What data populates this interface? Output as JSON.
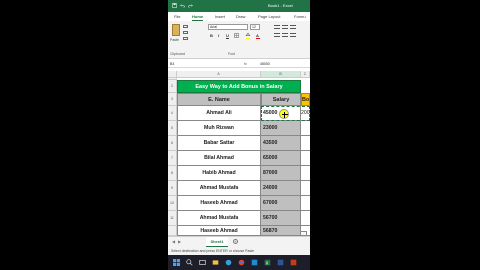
{
  "window": {
    "title": "Book1 - Excel",
    "quick_access": [
      "save-icon",
      "undo-icon",
      "redo-icon"
    ]
  },
  "ribbon_tabs": [
    "File",
    "Home",
    "Insert",
    "Draw",
    "Page Layout",
    "Formu"
  ],
  "ribbon": {
    "paste_label": "Paste",
    "clipboard_label": "Clipboard",
    "font_name": "Arial",
    "font_size": "12",
    "bold": "B",
    "italic": "I",
    "underline": "U",
    "font_group_label": "Font",
    "fill_color": "#ffff00",
    "font_color": "#ff0000"
  },
  "formula_bar": {
    "name_box": "B3",
    "fx": "fx",
    "value": "45000"
  },
  "columns": [
    "A",
    "B",
    "C"
  ],
  "rows": [
    "1",
    "2",
    "3",
    "4",
    "5",
    "6",
    "7",
    "8",
    "9",
    "10",
    "11"
  ],
  "sheet": {
    "title": "Easy Way to Add Bonus in Salary",
    "headers": {
      "name": "E. Name",
      "salary": "Salary",
      "bonus": "Bonus"
    },
    "records": [
      {
        "name": "Ahmad Ali",
        "salary": "45000",
        "bonus": "2000"
      },
      {
        "name": "Muh Rizwan",
        "salary": "23000",
        "bonus": ""
      },
      {
        "name": "Babar Sattar",
        "salary": "43500",
        "bonus": ""
      },
      {
        "name": "Bilal Ahmad",
        "salary": "65000",
        "bonus": ""
      },
      {
        "name": "Habib Ahmad",
        "salary": "87000",
        "bonus": ""
      },
      {
        "name": "Ahmad Mustafa",
        "salary": "24000",
        "bonus": ""
      },
      {
        "name": "Haseeb Ahmad",
        "salary": "67000",
        "bonus": ""
      },
      {
        "name": "Ahmad Mustafa",
        "salary": "56700",
        "bonus": ""
      },
      {
        "name": "Haseeb Ahmad",
        "salary": "56870",
        "bonus": ""
      }
    ]
  },
  "sheet_tabs": {
    "active": "Sheet1",
    "add": "+"
  },
  "status": "Select destination and press ENTER or choose Paste",
  "colors": {
    "excel_green": "#217346",
    "title_fill": "#00b050",
    "header_gray": "#bfbfbf",
    "bonus_header": "#ffc000"
  }
}
